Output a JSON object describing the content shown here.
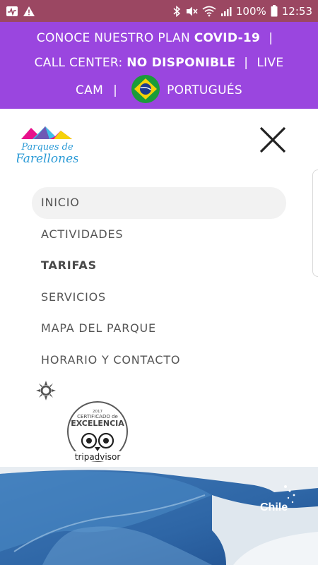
{
  "status_bar": {
    "battery_text": "100%",
    "time": "12:53",
    "icons": [
      "activity-icon",
      "warning-icon",
      "bluetooth-icon",
      "mute-icon",
      "wifi-icon",
      "signal-icon",
      "battery-icon"
    ]
  },
  "banner": {
    "line1_prefix": "CONOCE NUESTRO PLAN ",
    "line1_bold": "COVID-19",
    "line1_sep": "|",
    "line2_prefix": "CALL CENTER: ",
    "line2_bold": "NO DISPONIBLE",
    "line2_sep": "|",
    "line2_tail": "LIVE",
    "line3_cam": "CAM",
    "line3_sep": "|",
    "line3_language": "PORTUGUÉS",
    "flag": "brazil-flag-icon"
  },
  "header": {
    "logo_line1": "Parques de",
    "logo_line2": "Farellones",
    "close_icon": "close-icon"
  },
  "menu": {
    "items": [
      {
        "label": "INICIO"
      },
      {
        "label": "ACTIVIDADES"
      },
      {
        "label": "TARIFAS"
      },
      {
        "label": "SERVICIOS"
      },
      {
        "label": "MAPA DEL PARQUE"
      },
      {
        "label": "HORARIO Y CONTACTO"
      }
    ],
    "weather_icon": "sun-icon"
  },
  "badge": {
    "year": "2017",
    "line1": "CERTIFICADO de",
    "line2": "EXCELENCIA",
    "brand": "tripadvisor"
  },
  "hero": {
    "watermark": "Chile"
  },
  "colors": {
    "status_bar": "#9b4762",
    "banner": "#9a46df",
    "menu_text": "#555555",
    "active_bg": "#f2f2f2"
  }
}
